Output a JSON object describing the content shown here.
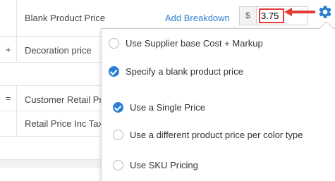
{
  "table": {
    "rows": [
      {
        "operator": "",
        "label": "Blank Product Price"
      },
      {
        "operator": "+",
        "label": "Decoration price"
      },
      {
        "operator": "",
        "label": ""
      },
      {
        "operator": "=",
        "label": "Customer Retail Price"
      },
      {
        "operator": "",
        "label": "Retail Price Inc Tax"
      }
    ],
    "add_breakdown_link": "Add Breakdown"
  },
  "price_field": {
    "currency_symbol": "$",
    "value": "3.75"
  },
  "settings": {
    "icon": "gear-icon",
    "icon_color": "#2d7fd3",
    "annotation_color": "#e53935"
  },
  "popup": {
    "options": [
      {
        "label": "Use Supplier base Cost + Markup",
        "checked": false
      },
      {
        "label": "Specify a blank product price",
        "checked": true
      },
      {
        "label": "Use a Single Price",
        "checked": true
      },
      {
        "label": "Use a different product price per color type",
        "checked": false
      },
      {
        "label": "Use SKU Pricing",
        "checked": false
      }
    ]
  },
  "colors": {
    "accent": "#2d7fd3",
    "highlight": "#e53935"
  }
}
